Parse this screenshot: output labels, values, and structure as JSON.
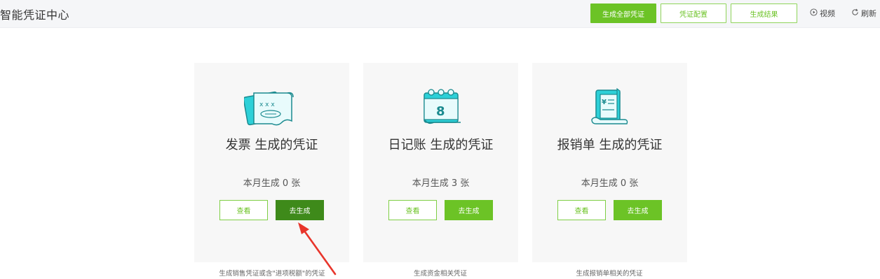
{
  "header": {
    "title": "智能凭证中心",
    "buttons": {
      "generate_all": "生成全部凭证",
      "config": "凭证配置",
      "result": "生成结果"
    },
    "links": {
      "video": "视频",
      "refresh": "刷新"
    }
  },
  "cards": [
    {
      "title": "发票 生成的凭证",
      "count": "本月生成 0 张",
      "view": "查看",
      "generate": "去生成",
      "desc": "生成销售凭证或含\"进项税额\"的凭证",
      "icon": "invoice-icon"
    },
    {
      "title": "日记账 生成的凭证",
      "count": "本月生成 3 张",
      "view": "查看",
      "generate": "去生成",
      "desc": "生成资金相关凭证",
      "icon": "calendar-icon"
    },
    {
      "title": "报销单 生成的凭证",
      "count": "本月生成  0 张",
      "view": "查看",
      "generate": "去生成",
      "desc": "生成报销单相关的凭证",
      "icon": "receipt-icon"
    }
  ],
  "colors": {
    "accent": "#6cc326",
    "accent_dark": "#3e8a1a",
    "icon_cyan": "#2dd0d8",
    "arrow": "#e8352b"
  }
}
